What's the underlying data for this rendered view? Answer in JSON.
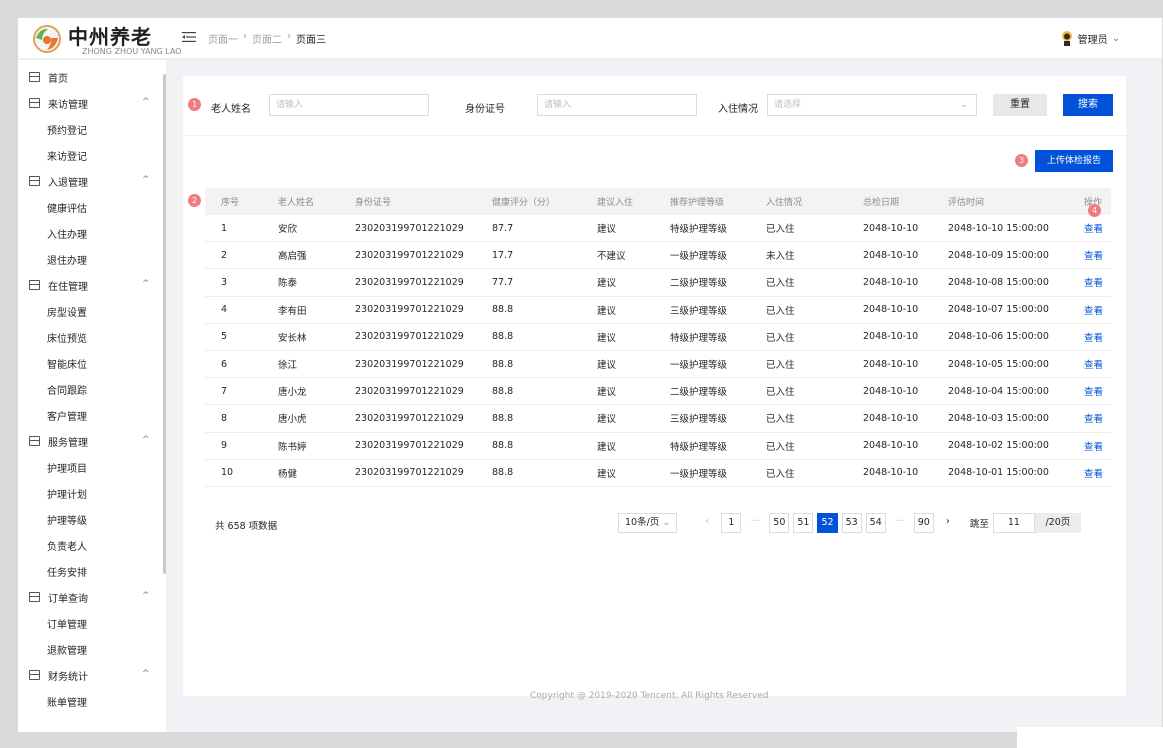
{
  "app": {
    "title": "中州养老",
    "subtitle": "ZHONG ZHOU YANG LAO"
  },
  "breadcrumb": [
    "页面一",
    "页面二",
    "页面三"
  ],
  "user": {
    "name": "管理员"
  },
  "sidebar": {
    "home": "首页",
    "groups": [
      {
        "label": "来访管理",
        "items": [
          "预约登记",
          "来访登记"
        ]
      },
      {
        "label": "入退管理",
        "items": [
          "健康评估",
          "入住办理",
          "退住办理"
        ]
      },
      {
        "label": "在住管理",
        "items": [
          "房型设置",
          "床位预览",
          "智能床位",
          "合同跟踪",
          "客户管理"
        ]
      },
      {
        "label": "服务管理",
        "items": [
          "护理项目",
          "护理计划",
          "护理等级",
          "负责老人",
          "任务安排"
        ]
      },
      {
        "label": "订单查询",
        "items": [
          "订单管理",
          "退款管理"
        ]
      },
      {
        "label": "财务统计",
        "items": [
          "账单管理"
        ]
      }
    ]
  },
  "search": {
    "badge": "1",
    "name_label": "老人姓名",
    "name_placeholder": "请输入",
    "id_label": "身份证号",
    "id_placeholder": "请输入",
    "status_label": "入住情况",
    "status_placeholder": "请选择",
    "reset_label": "重置",
    "search_label": "搜索"
  },
  "upload": {
    "badge": "3",
    "label": "上传体检报告"
  },
  "table": {
    "badge": "2",
    "op_badge": "4",
    "columns": [
      "序号",
      "老人姓名",
      "身份证号",
      "健康评分（分）",
      "建议入住",
      "推荐护理等级",
      "入住情况",
      "总检日期",
      "评估时间",
      "操作"
    ],
    "rows": [
      [
        "1",
        "安欣",
        "230203199701221029",
        "87.7",
        "建议",
        "特级护理等级",
        "已入住",
        "2048-10-10",
        "2048-10-10 15:00:00",
        "查看"
      ],
      [
        "2",
        "高启强",
        "230203199701221029",
        "17.7",
        "不建议",
        "一级护理等级",
        "未入住",
        "2048-10-10",
        "2048-10-09 15:00:00",
        "查看"
      ],
      [
        "3",
        "陈泰",
        "230203199701221029",
        "77.7",
        "建议",
        "二级护理等级",
        "已入住",
        "2048-10-10",
        "2048-10-08 15:00:00",
        "查看"
      ],
      [
        "4",
        "李有田",
        "230203199701221029",
        "88.8",
        "建议",
        "三级护理等级",
        "已入住",
        "2048-10-10",
        "2048-10-07 15:00:00",
        "查看"
      ],
      [
        "5",
        "安长林",
        "230203199701221029",
        "88.8",
        "建议",
        "特级护理等级",
        "已入住",
        "2048-10-10",
        "2048-10-06 15:00:00",
        "查看"
      ],
      [
        "6",
        "徐江",
        "230203199701221029",
        "88.8",
        "建议",
        "一级护理等级",
        "已入住",
        "2048-10-10",
        "2048-10-05 15:00:00",
        "查看"
      ],
      [
        "7",
        "唐小龙",
        "230203199701221029",
        "88.8",
        "建议",
        "二级护理等级",
        "已入住",
        "2048-10-10",
        "2048-10-04 15:00:00",
        "查看"
      ],
      [
        "8",
        "唐小虎",
        "230203199701221029",
        "88.8",
        "建议",
        "三级护理等级",
        "已入住",
        "2048-10-10",
        "2048-10-03 15:00:00",
        "查看"
      ],
      [
        "9",
        "陈书婷",
        "230203199701221029",
        "88.8",
        "建议",
        "特级护理等级",
        "已入住",
        "2048-10-10",
        "2048-10-02 15:00:00",
        "查看"
      ],
      [
        "10",
        "杨健",
        "230203199701221029",
        "88.8",
        "建议",
        "一级护理等级",
        "已入住",
        "2048-10-10",
        "2048-10-01 15:00:00",
        "查看"
      ]
    ]
  },
  "pagination": {
    "total_text": "共 658 项数据",
    "page_size": "10条/页",
    "pages": [
      "1",
      "···",
      "50",
      "51",
      "52",
      "53",
      "54",
      "···",
      "90"
    ],
    "current": "52",
    "jump_label": "跳至",
    "jump_value": "11",
    "jump_suffix": "/20页"
  },
  "footer": {
    "copyright": "Copyright @ 2019-2020 Tencent. All Rights Reserved"
  },
  "colors": {
    "primary": "#0052d9",
    "badge": "#f07c82"
  }
}
